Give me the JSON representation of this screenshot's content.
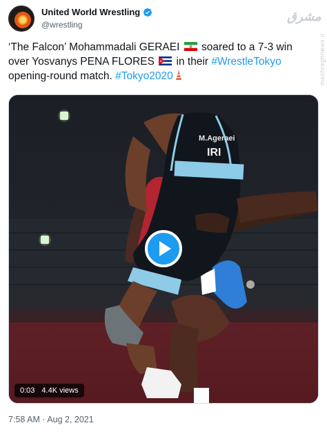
{
  "account": {
    "display_name": "United World Wrestling",
    "handle": "@wrestling",
    "verified": true
  },
  "tweet": {
    "part1": "‘The Falcon’ Mohammadali GERAEI ",
    "part2": " soared to a 7-3 win over Yosvanys PENA FLORES ",
    "part3": " in their ",
    "hashtag1": "#WrestleTokyo",
    "part4": " opening-round match. ",
    "hashtag2": "#Tokyo2020",
    "flag1": "iran-flag",
    "flag2": "cuba-flag",
    "emoji": "tokyo-tower-icon"
  },
  "video": {
    "duration": "0:03",
    "views": "4.4K views",
    "singlet_name": "M.Ageraei",
    "singlet_country": "IRI"
  },
  "timestamp": "7:58 AM · Aug 2, 2021",
  "watermark": {
    "logo": "مشرق",
    "side": "mashreghnews.ir"
  },
  "colors": {
    "link": "#1d9bf0",
    "secondary_text": "#536471",
    "singlet": "#11161c",
    "singlet_accent": "#8ecbe6"
  }
}
